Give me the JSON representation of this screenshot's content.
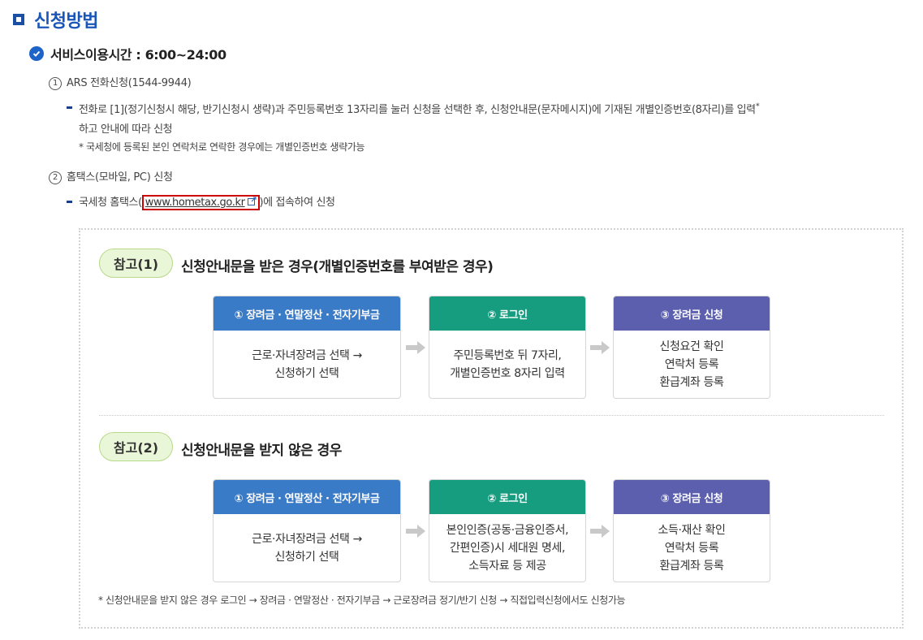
{
  "title": "신청방법",
  "section": {
    "label": "서비스이용시간 : 6:00~24:00"
  },
  "method1": {
    "num": "1",
    "label": "ARS 전화신청(1544-9944)",
    "desc_line1": "전화로 [1](정기신청시 해당, 반기신청시 생략)과 주민등록번호 13자리를 눌러 신청을 선택한 후, 신청안내문(문자메시지)에 기재된 개별인증번호(8자리)를 입력",
    "desc_line1_mark": "*",
    "desc_line2": "하고 안내에 따라 신청",
    "note": "* 국세청에 등록된 본인 연락처로 연락한 경우에는 개별인증번호 생략가능"
  },
  "method2": {
    "num": "2",
    "label": "홈택스(모바일, PC) 신청",
    "prefix": "국세청 홈택스(",
    "link": "www.hometax.go.kr",
    "suffix": ")에 접속하여 신청"
  },
  "ref1": {
    "badge": "참고(1)",
    "title": "신청안내문을 받은 경우(개별인증번호를 부여받은 경우)",
    "steps": [
      {
        "head": "① 장려금 · 연말정산 · 전자기부금",
        "body": "근로·자녀장려금 선택 →\n신청하기 선택"
      },
      {
        "head": "② 로그인",
        "body": "주민등록번호 뒤 7자리,\n개별인증번호 8자리 입력"
      },
      {
        "head": "③ 장려금 신청",
        "body": "신청요건 확인\n연락처 등록\n환급계좌 등록"
      }
    ]
  },
  "ref2": {
    "badge": "참고(2)",
    "title": "신청안내문을 받지 않은 경우",
    "steps": [
      {
        "head": "① 장려금 · 연말정산 · 전자기부금",
        "body": "근로·자녀장려금 선택 →\n신청하기 선택"
      },
      {
        "head": "② 로그인",
        "body": "본인인증(공동·금융인증서,\n간편인증)시 세대원 명세,\n소득자료 등 제공"
      },
      {
        "head": "③ 장려금 신청",
        "body": "소득·재산 확인\n연락처 등록\n환급계좌 등록"
      }
    ]
  },
  "bottom_note": "* 신청안내문을 받지 않은 경우 로그인 → 장려금 · 연말정산 · 전자기부금 → 근로장려금 정기/반기 신청 → 직접입력신청에서도 신청가능",
  "colors": {
    "step1": "#3a7bc8",
    "step2": "#169c7e",
    "step3": "#5b5fad",
    "accent": "#1a56b8"
  }
}
